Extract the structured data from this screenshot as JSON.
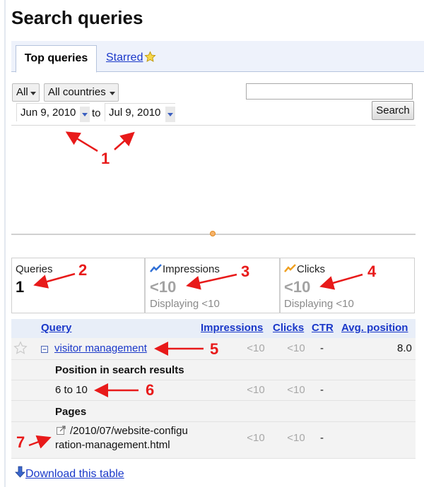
{
  "page": {
    "title": "Search queries"
  },
  "tabs": {
    "top_queries": "Top queries",
    "starred": "Starred"
  },
  "filters": {
    "type_value": "All",
    "country_value": "All countries",
    "date_from": "Jun 9, 2010",
    "date_to_label": "to",
    "date_to": "Jul 9, 2010",
    "search_placeholder": "",
    "search_button": "Search"
  },
  "stats": {
    "queries": {
      "label": "Queries",
      "value": "1"
    },
    "impressions": {
      "label": "Impressions",
      "value": "<10",
      "sub": "Displaying <10"
    },
    "clicks": {
      "label": "Clicks",
      "value": "<10",
      "sub": "Displaying <10"
    }
  },
  "table": {
    "headers": {
      "query": "Query",
      "impressions": "Impressions",
      "clicks": "Clicks",
      "ctr": "CTR",
      "avg_position": "Avg. position"
    },
    "query_row": {
      "query": "visitor management",
      "impressions": "<10",
      "clicks": "<10",
      "ctr": "-",
      "avg_position": "8.0"
    },
    "position_heading": "Position in search results",
    "position_row": {
      "label": "6 to 10",
      "impressions": "<10",
      "clicks": "<10",
      "ctr": "-"
    },
    "pages_heading": "Pages",
    "page_row": {
      "url_line1": "/2010/07/website-configu",
      "url_line2": "ration-management.html",
      "impressions": "<10",
      "clicks": "<10",
      "ctr": "-"
    }
  },
  "download": {
    "label": "Download this table"
  },
  "annotations": [
    "1",
    "2",
    "3",
    "4",
    "5",
    "6",
    "7"
  ],
  "colors": {
    "link": "#1a38c9",
    "annotation": "#e81a1a",
    "tab_bar": "#eef2fb",
    "header_row": "#e8eef8"
  },
  "icons": {
    "star": "star-icon",
    "impressions": "impressions-trend-icon",
    "clicks": "clicks-trend-icon",
    "collapse": "collapse-icon",
    "external": "external-link-icon",
    "download": "download-arrow-icon"
  }
}
